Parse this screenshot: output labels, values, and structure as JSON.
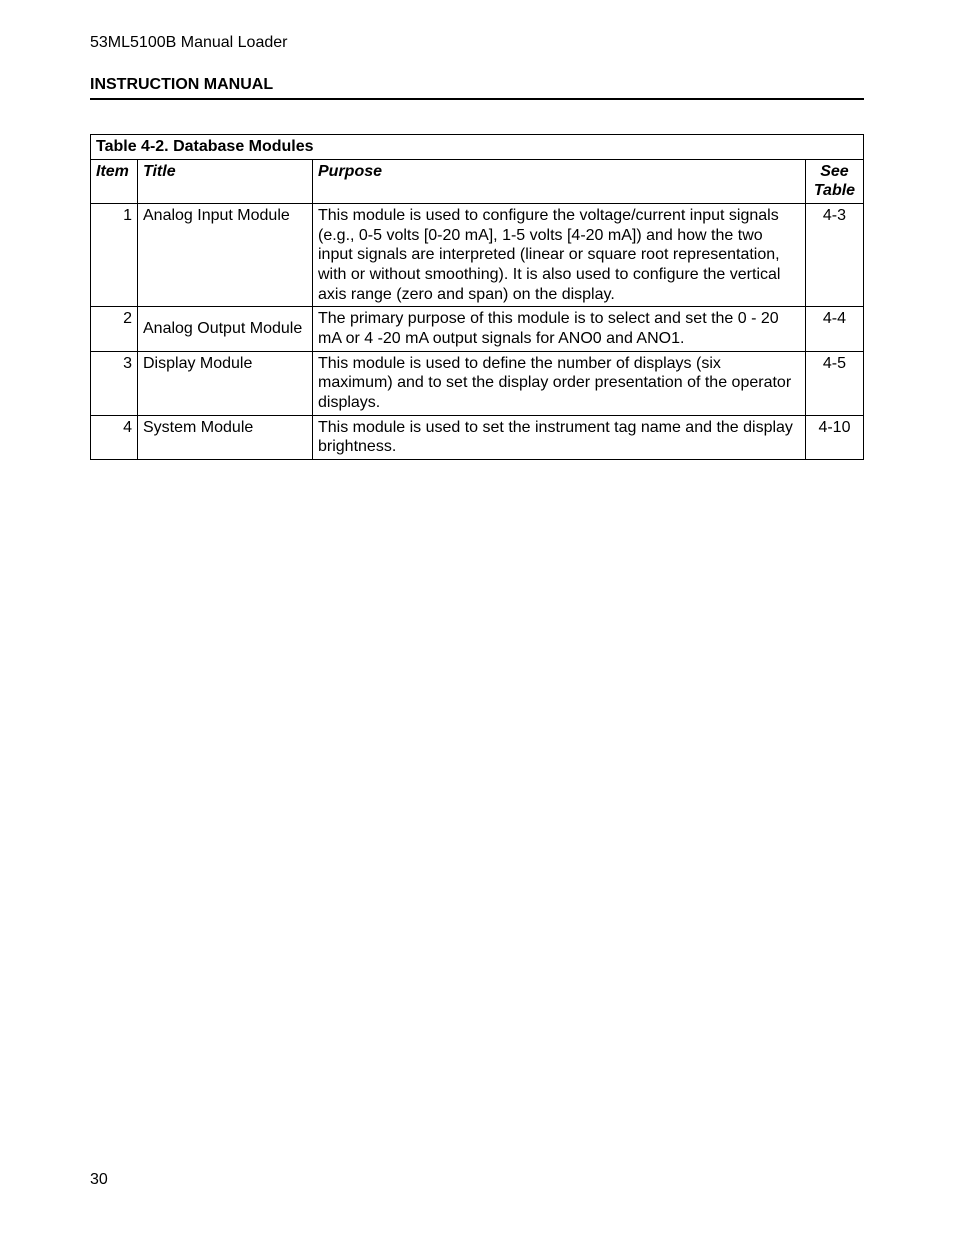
{
  "header": {
    "product": "53ML5100B Manual Loader",
    "doc_type": "INSTRUCTION MANUAL"
  },
  "table": {
    "caption": "Table 4-2. Database Modules",
    "headers": {
      "item": "Item",
      "title": "Title",
      "purpose": "Purpose",
      "see": "See Table"
    },
    "rows": [
      {
        "item": "1",
        "title": "Analog Input Module",
        "purpose": "This module is used to configure the voltage/current input signals (e.g., 0-5 volts [0-20 mA], 1-5 volts [4-20 mA]) and how the two input signals are interpreted (linear or square root representation, with or without smoothing). It is also used to configure the vertical axis range (zero and span) on the display.",
        "see": "4-3"
      },
      {
        "item": "2",
        "title": "Analog Output Module",
        "purpose": "The primary purpose of this module is to select and set the 0 - 20 mA or 4 -20 mA output signals for ANO0 and ANO1.",
        "see": "4-4"
      },
      {
        "item": "3",
        "title": "Display Module",
        "purpose": "This module is used to define the number of displays (six maximum) and to set the display order presentation of the operator displays.",
        "see": "4-5"
      },
      {
        "item": "4",
        "title": "System Module",
        "purpose": "This module is used to set the instrument tag name and the display brightness.",
        "see": "4-10"
      }
    ]
  },
  "page_number": "30"
}
